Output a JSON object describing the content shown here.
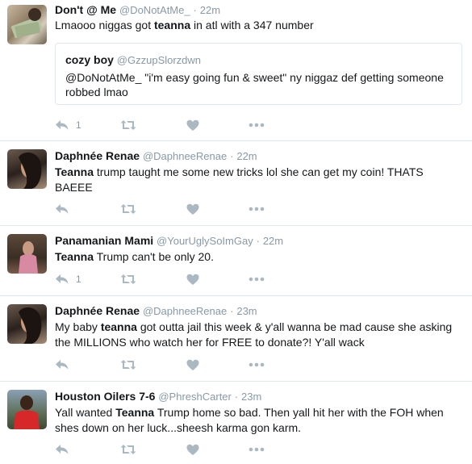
{
  "colors": {
    "action_icon": "#aab8c2",
    "text": "#14171a",
    "muted": "#8899a6",
    "border": "#e1e8ed"
  },
  "tweets": [
    {
      "name": "Don't @ Me",
      "handle": "@DoNotAtMe_",
      "dot": "·",
      "time": "22m",
      "text_pre": "Lmaooo niggas got ",
      "bold": "teanna",
      "text_post": " in atl with a 347 number",
      "quote": {
        "name": "cozy boy",
        "handle": "@GzzupSlorzdwn",
        "text": "@DoNotAtMe_ \"i'm easy going fun & sweet\" ny niggaz def getting someone robbed lmao"
      },
      "reply_count": "1",
      "avatar_icon": "money-photo-avatar"
    },
    {
      "name": "Daphnée Renae",
      "handle": "@DaphneeRenae",
      "dot": "·",
      "time": "22m",
      "text_pre": "",
      "bold": "Teanna",
      "text_post": " trump taught me some new tricks lol she can get my coin! THATS BAEEE",
      "reply_count": "",
      "avatar_icon": "person-photo-avatar"
    },
    {
      "name": "Panamanian Mami",
      "handle": "@YourUglySoImGay",
      "dot": "·",
      "time": "22m",
      "text_pre": "",
      "bold": "Teanna",
      "text_post": " Trump can't be only 20.",
      "reply_count": "1",
      "avatar_icon": "person-photo-avatar"
    },
    {
      "name": "Daphnée Renae",
      "handle": "@DaphneeRenae",
      "dot": "·",
      "time": "23m",
      "text_pre": "My baby ",
      "bold": "teanna",
      "text_post": " got outta jail this week & y'all wanna be mad cause she asking the MILLIONS who watch her for FREE to donate?! Y'all wack",
      "reply_count": "",
      "avatar_icon": "person-photo-avatar"
    },
    {
      "name": "Houston Oilers 7-6",
      "handle": "@PhreshCarter",
      "dot": "·",
      "time": "23m",
      "text_pre": "Yall wanted ",
      "bold": "Teanna",
      "text_post": " Trump home so bad. Then yall hit her with the FOH when shes down on her luck...sheesh karma gon karm.",
      "reply_count": "",
      "avatar_icon": "person-photo-avatar"
    }
  ]
}
